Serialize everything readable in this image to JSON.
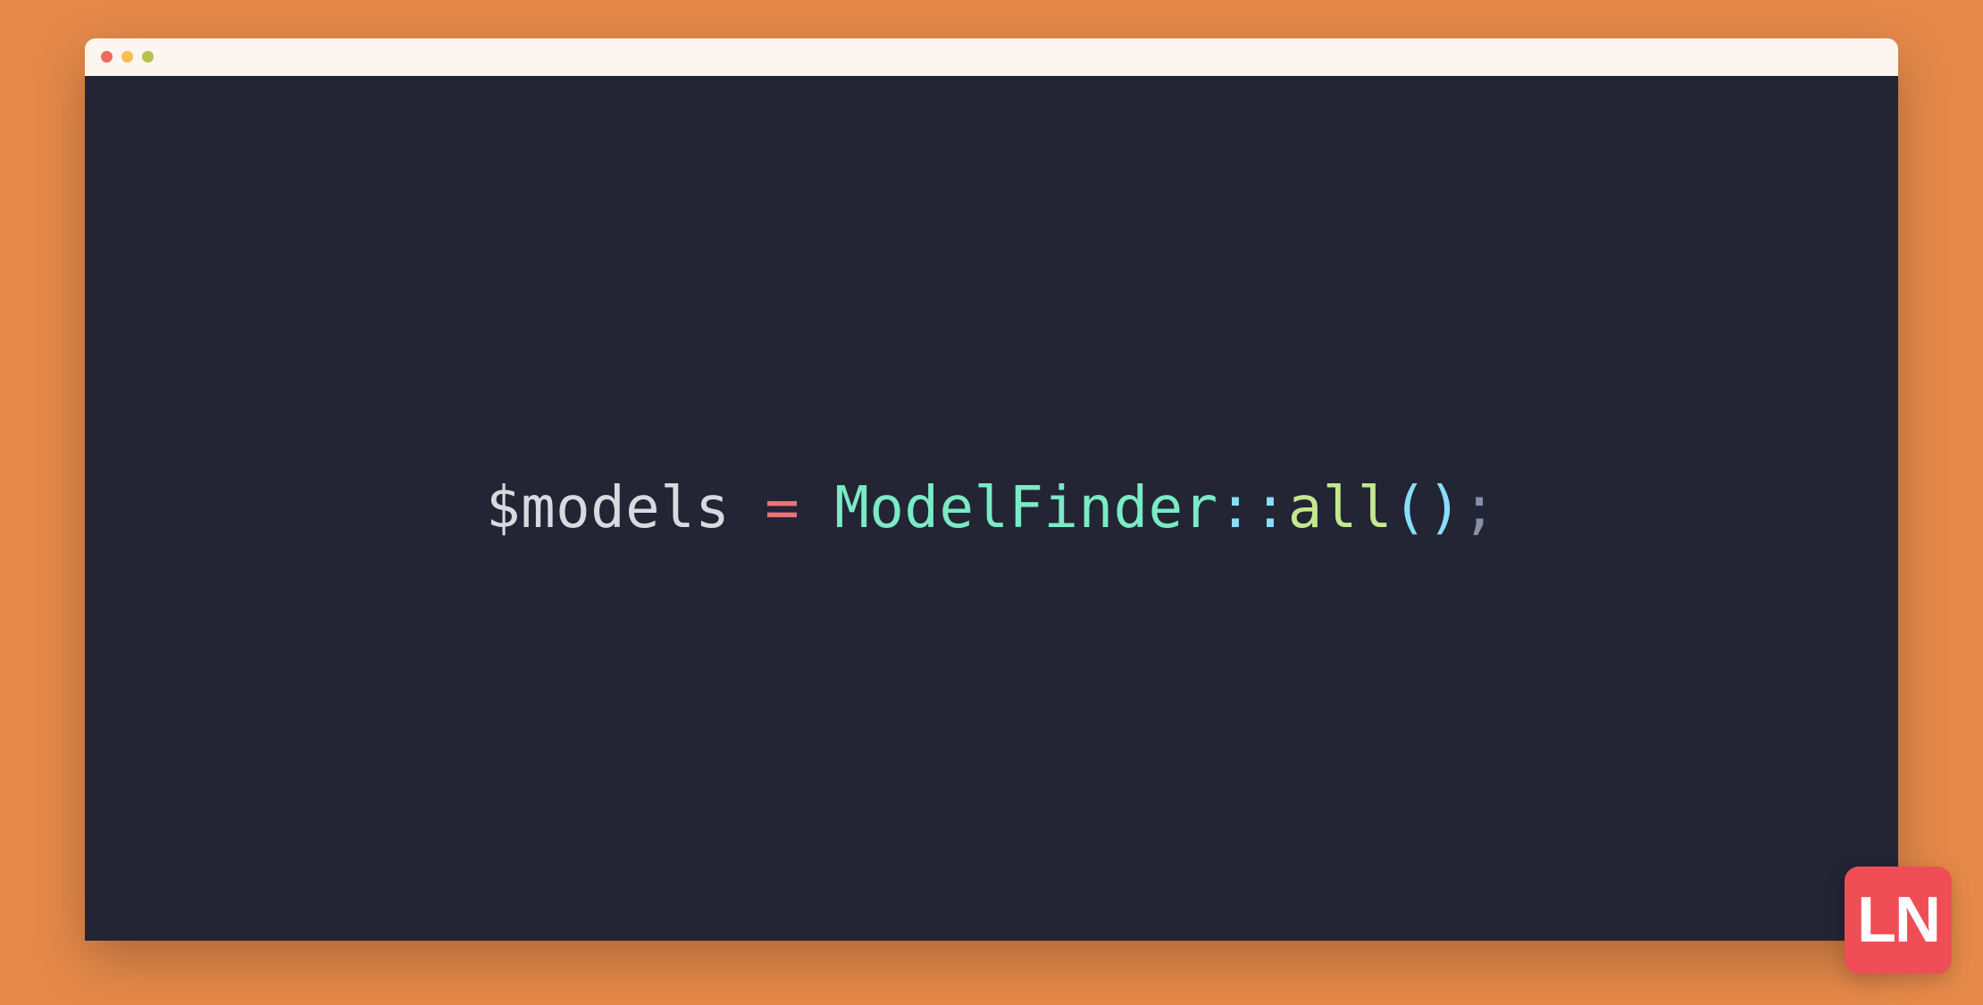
{
  "colors": {
    "background": "#e68a4a",
    "titlebar": "#fdf5f0",
    "editor": "#232535",
    "dot_close": "#ed6a5e",
    "dot_min": "#f5be4f",
    "dot_max": "#b6c34f",
    "token_variable": "#d9d9e0",
    "token_operator": "#f07178",
    "token_class": "#79ebc5",
    "token_scope": "#89ddff",
    "token_method": "#c3e88d",
    "token_paren": "#89ddff",
    "token_punct": "#8890a8",
    "logo_bg": "#ef4e56",
    "logo_fg": "#ffffff"
  },
  "code": {
    "variable": "$models",
    "space1": " ",
    "operator": "=",
    "space2": " ",
    "class": "ModelFinder",
    "scope": "::",
    "method": "all",
    "paren_open": "(",
    "paren_close": ")",
    "semicolon": ";"
  },
  "logo": {
    "text": "LN"
  }
}
